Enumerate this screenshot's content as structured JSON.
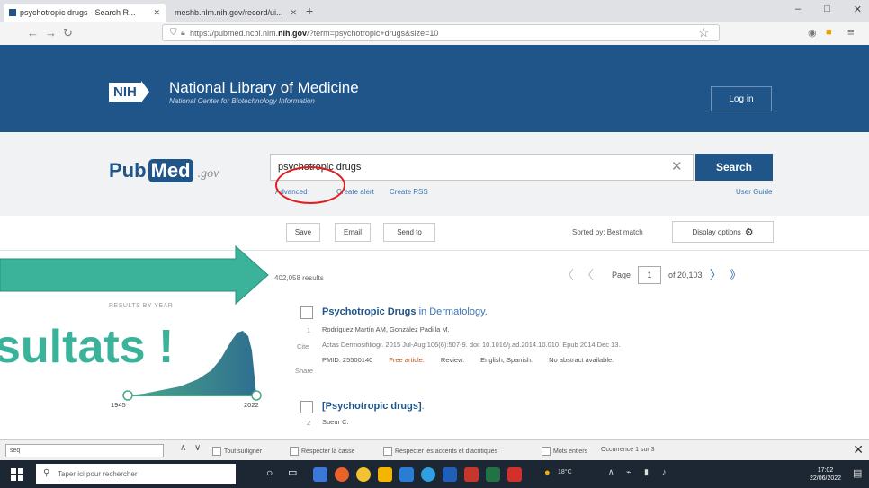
{
  "browser": {
    "tabs": [
      {
        "label": "psychotropic drugs - Search R..."
      },
      {
        "label": "meshb.nlm.nih.gov/record/ui..."
      }
    ],
    "new_tab": "+",
    "url_prefix": "https://pubmed.ncbi.nlm.",
    "url_domain": "nih.gov",
    "url_suffix": "/?term=psychotropic+drugs&size=10",
    "window_controls": [
      "–",
      "□",
      "✕"
    ]
  },
  "nih": {
    "badge": "NIH",
    "title": "National Library of Medicine",
    "subtitle": "National Center for Biotechnology Information",
    "login": "Log in"
  },
  "search": {
    "logo_pub": "Pub",
    "logo_med": "Med",
    "logo_gov": ".gov",
    "query": "psychotropic drugs",
    "button": "Search",
    "advanced": "Advanced",
    "create_alert": "Create alert",
    "create_rss": "Create RSS",
    "user_guide": "User Guide"
  },
  "toolbar": {
    "save": "Save",
    "email": "Email",
    "send_to": "Send to",
    "sorted_by": "Sorted by: Best match",
    "display_options": "Display options"
  },
  "results": {
    "count": "402,058 results",
    "page_label": "Page",
    "page_value": "1",
    "page_of": "of 20,103",
    "items": [
      {
        "index": "1",
        "title_bold": "Psychotropic Drugs",
        "title_rest": " in Dermatology.",
        "authors": "Rodríguez Martín AM, González Padilla M.",
        "journal": "Actas Dermosifiliogr. 2015 Jul-Aug;106(6):507-9. doi: 10.1016/j.ad.2014.10.010. Epub 2014 Dec 13.",
        "pmid": "PMID: 25500140",
        "free": "Free article.",
        "type": "Review.",
        "lang": "English, Spanish.",
        "abstract": "No abstract available."
      },
      {
        "index": "2",
        "title_bold": "[Psychotropic drugs]",
        "title_rest": ".",
        "authors": "Sueur C."
      }
    ],
    "cite": "Cite",
    "share": "Share"
  },
  "sidebar": {
    "results_by_year": "RESULTS BY YEAR",
    "year_start": "1945",
    "year_end": "2022"
  },
  "overlay": {
    "text": "sultats !"
  },
  "findbar": {
    "query": "seq",
    "options": [
      "Tout surligner",
      "Respecter la casse",
      "Respecter les accents et diacritiques",
      "Mots entiers"
    ],
    "occurrence": "Occurrence 1 sur 3"
  },
  "taskbar": {
    "search_placeholder": "Taper ici pour rechercher",
    "weather": "18°C",
    "time": "17:02",
    "date": "22/06/2022"
  },
  "colors": {
    "nih_blue": "#20558a",
    "link_blue": "#3d75b3",
    "annotation_green": "#3bb39a",
    "annotation_red": "#e02020"
  }
}
